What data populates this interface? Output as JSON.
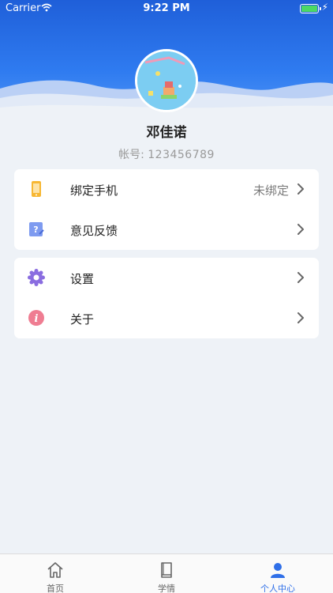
{
  "status_bar": {
    "carrier": "Carrier",
    "time": "9:22 PM"
  },
  "profile": {
    "name": "邓佳诺",
    "account_label": "帐号:",
    "account_value": "123456789"
  },
  "menu_group_1": [
    {
      "label": "绑定手机",
      "value": "未绑定",
      "icon": "phone-icon"
    },
    {
      "label": "意见反馈",
      "value": "",
      "icon": "feedback-icon"
    }
  ],
  "menu_group_2": [
    {
      "label": "设置",
      "icon": "gear-icon"
    },
    {
      "label": "关于",
      "icon": "info-icon"
    }
  ],
  "tabbar": {
    "items": [
      {
        "label": "首页",
        "icon": "home-icon"
      },
      {
        "label": "学情",
        "icon": "book-icon"
      },
      {
        "label": "个人中心",
        "icon": "user-icon"
      }
    ],
    "active_index": 2
  },
  "colors": {
    "header": "#2f7bf0",
    "accent": "#2f6fe8",
    "background": "#eef2f7"
  }
}
